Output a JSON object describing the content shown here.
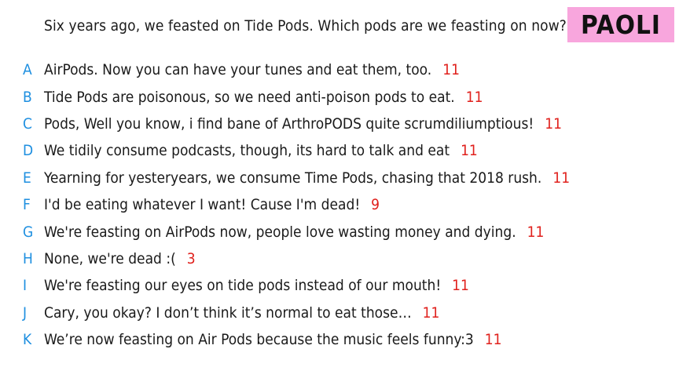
{
  "prompt": "Six years ago, we feasted on Tide Pods. Which pods are we feasting on now?",
  "player_name": "PAOLI",
  "colors": {
    "letter": "#1e8fe0",
    "score": "#e0201c",
    "name_tag_bg": "#f8a6dd"
  },
  "answers": [
    {
      "letter": "A",
      "text": "AirPods. Now you can have your tunes and eat them, too.",
      "score": "11"
    },
    {
      "letter": "B",
      "text": "Tide Pods are poisonous, so we need anti-poison pods to eat.",
      "score": "11"
    },
    {
      "letter": "C",
      "text": "Pods, Well you know, i find bane of ArthroPODS quite scrumdiliumptious!",
      "score": "11"
    },
    {
      "letter": "D",
      "text": "We tidily consume podcasts, though, its hard to talk and eat",
      "score": "11"
    },
    {
      "letter": "E",
      "text": "Yearning for yesteryears, we consume Time Pods, chasing that 2018 rush.",
      "score": "11"
    },
    {
      "letter": "F",
      "text": "I'd be eating whatever I want! Cause I'm dead!",
      "score": "9"
    },
    {
      "letter": "G",
      "text": "We're feasting on AirPods now, people love wasting money and dying.",
      "score": "11"
    },
    {
      "letter": "H",
      "text": "None, we're dead :(",
      "score": "3"
    },
    {
      "letter": "I",
      "text": "We're feasting our eyes on tide pods instead of our mouth!",
      "score": "11"
    },
    {
      "letter": "J",
      "text": "Cary, you okay? I don’t think it’s normal to eat those…",
      "score": "11"
    },
    {
      "letter": "K",
      "text": "We’re now feasting on Air Pods because the music feels funny:3",
      "score": "11"
    }
  ]
}
